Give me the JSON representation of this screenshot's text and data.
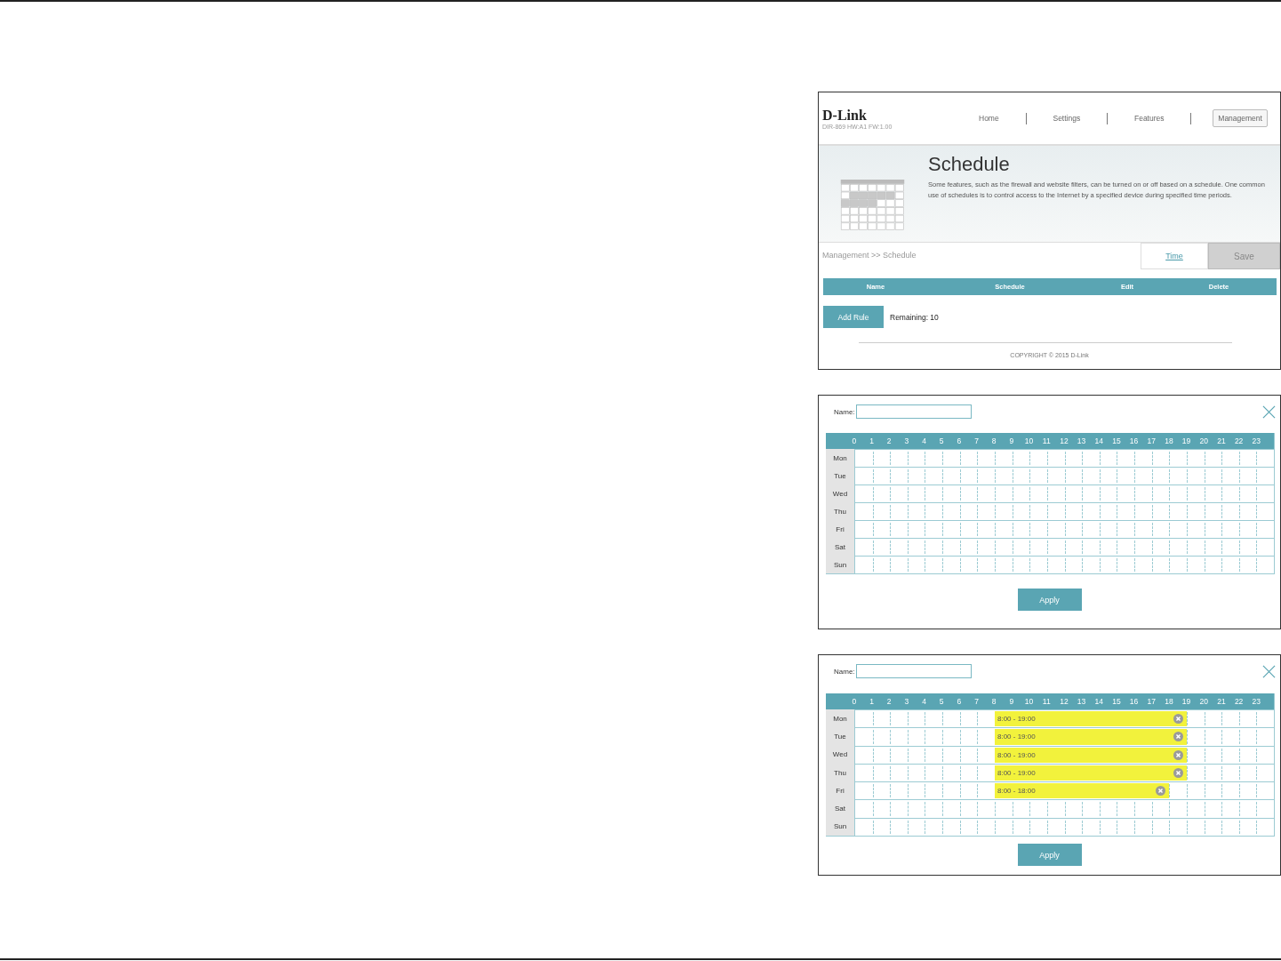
{
  "schedule_page": {
    "brand": "D-Link",
    "model": "DIR-869 HW:A1 FW:1.00",
    "nav": [
      {
        "label": "Home",
        "selected": false
      },
      {
        "label": "Settings",
        "selected": false
      },
      {
        "label": "Features",
        "selected": false
      },
      {
        "label": "Management",
        "selected": true
      }
    ],
    "title": "Schedule",
    "description": "Some features, such as the firewall and website filters, can be turned on or off based on a schedule. One common use of schedules is to control access to the Internet by a specified device during specified time periods.",
    "breadcrumb": "Management >> Schedule",
    "time_link": "Time",
    "save_button": "Save",
    "columns": [
      "Name",
      "Schedule",
      "Edit",
      "Delete"
    ],
    "add_rule_button": "Add Rule",
    "remaining": "Remaining: 10",
    "copyright": "COPYRIGHT © 2015 D-Link"
  },
  "editors": [
    {
      "name_label": "Name:",
      "hours": [
        "0",
        "1",
        "2",
        "3",
        "4",
        "5",
        "6",
        "7",
        "8",
        "9",
        "10",
        "11",
        "12",
        "13",
        "14",
        "15",
        "16",
        "17",
        "18",
        "19",
        "20",
        "21",
        "22",
        "23"
      ],
      "apply_button": "Apply",
      "days": [
        {
          "label": "Mon"
        },
        {
          "label": "Tue"
        },
        {
          "label": "Wed"
        },
        {
          "label": "Thu"
        },
        {
          "label": "Fri"
        },
        {
          "label": "Sat"
        },
        {
          "label": "Sun"
        }
      ]
    },
    {
      "name_label": "Name:",
      "hours": [
        "0",
        "1",
        "2",
        "3",
        "4",
        "5",
        "6",
        "7",
        "8",
        "9",
        "10",
        "11",
        "12",
        "13",
        "14",
        "15",
        "16",
        "17",
        "18",
        "19",
        "20",
        "21",
        "22",
        "23"
      ],
      "apply_button": "Apply",
      "days": [
        {
          "label": "Mon",
          "rules": [
            {
              "label": "8:00 - 19:00"
            }
          ]
        },
        {
          "label": "Tue",
          "rules": [
            {
              "label": "8:00 - 19:00"
            }
          ]
        },
        {
          "label": "Wed",
          "rules": [
            {
              "label": "8:00 - 19:00"
            }
          ]
        },
        {
          "label": "Thu",
          "rules": [
            {
              "label": "8:00 - 19:00"
            }
          ]
        },
        {
          "label": "Fri",
          "rules": [
            {
              "label": "8:00 - 18:00"
            }
          ]
        },
        {
          "label": "Sat"
        },
        {
          "label": "Sun"
        }
      ]
    }
  ]
}
